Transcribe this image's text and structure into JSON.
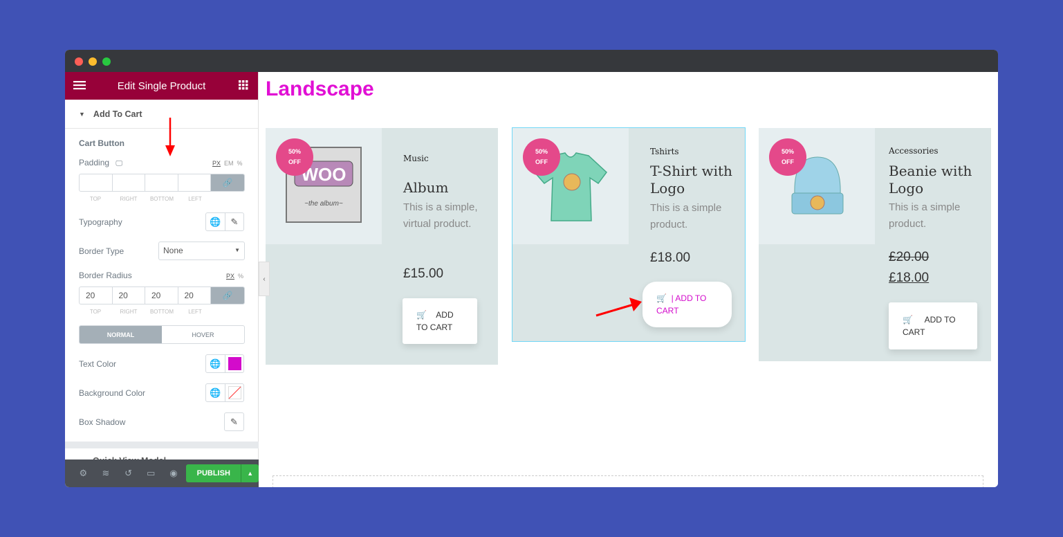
{
  "window": {
    "dots": [
      "#fe5f57",
      "#febc2e",
      "#28c840"
    ]
  },
  "sidebar": {
    "title": "Edit Single Product",
    "section": "Add To Cart",
    "subheading": "Cart Button",
    "padding": {
      "label": "Padding",
      "units": [
        "PX",
        "EM",
        "%"
      ],
      "values": [
        "",
        "",
        "",
        ""
      ],
      "labels": [
        "TOP",
        "RIGHT",
        "BOTTOM",
        "LEFT"
      ]
    },
    "typography": "Typography",
    "border_type": {
      "label": "Border Type",
      "value": "None"
    },
    "border_radius": {
      "label": "Border Radius",
      "units": [
        "PX",
        "%"
      ],
      "values": [
        "20",
        "20",
        "20",
        "20"
      ],
      "labels": [
        "TOP",
        "RIGHT",
        "BOTTOM",
        "LEFT"
      ]
    },
    "tabs": [
      "NORMAL",
      "HOVER"
    ],
    "text_color": {
      "label": "Text Color",
      "value": "#d30bcb"
    },
    "background_color": {
      "label": "Background Color"
    },
    "box_shadow": "Box Shadow",
    "next_section": "Quick View Modal",
    "publish": "PUBLISH"
  },
  "main": {
    "heading": "Landscape",
    "heading_color": "#e10fd4",
    "products": [
      {
        "badge": [
          "50%",
          "OFF"
        ],
        "category": "Music",
        "title": "Album",
        "desc": "This is a simple, virtual product.",
        "price": "£15.00",
        "button": "ADD TO CART"
      },
      {
        "badge": [
          "50%",
          "OFF"
        ],
        "category": "Tshirts",
        "title": "T-Shirt with Logo",
        "desc": "This is a simple product.",
        "price": "£18.00",
        "button": "|  ADD TO CART"
      },
      {
        "badge": [
          "50%",
          "OFF"
        ],
        "category": "Accessories",
        "title": "Beanie with Logo",
        "desc": "This is a simple product.",
        "old_price": "£20.00",
        "price": "£18.00",
        "button": "ADD TO CART"
      }
    ]
  }
}
